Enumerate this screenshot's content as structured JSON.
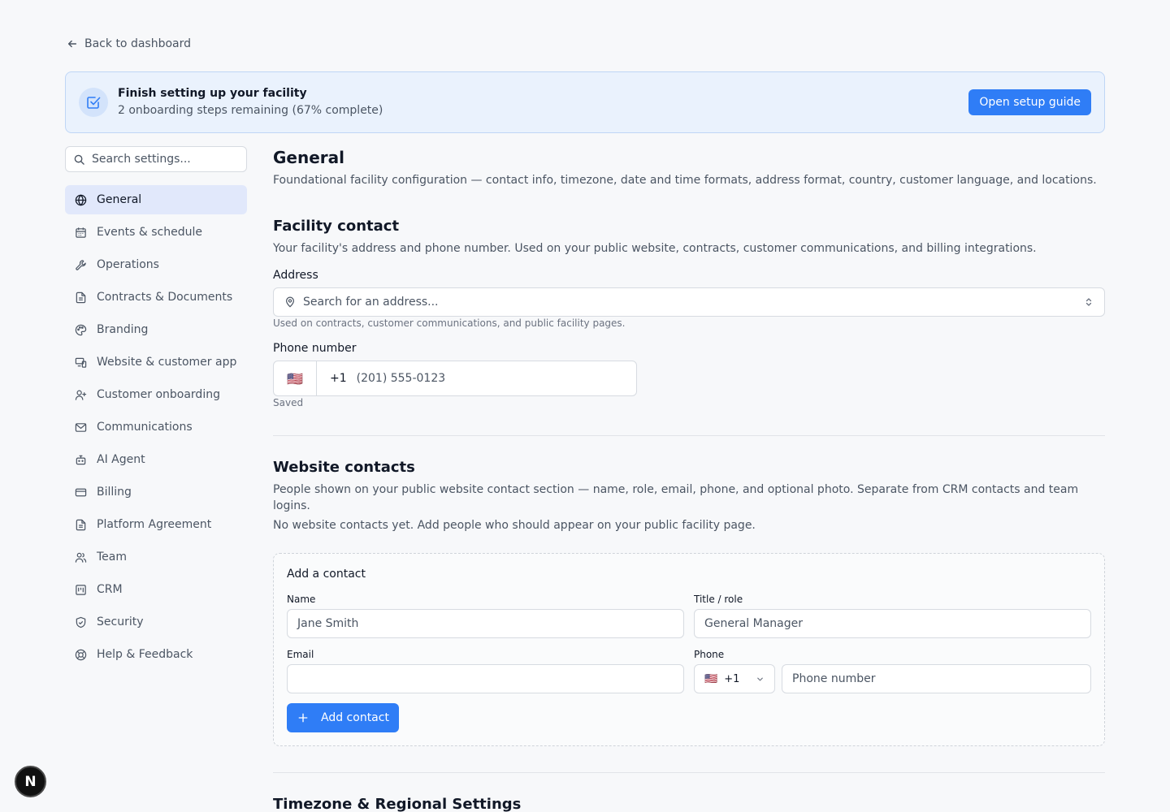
{
  "back_link": {
    "label": "Back to dashboard"
  },
  "banner": {
    "title": "Finish setting up your facility",
    "subtitle": "2 onboarding steps remaining (67% complete)",
    "button_label": "Open setup guide",
    "progress_percent": 67
  },
  "sidebar": {
    "search_placeholder": "Search settings...",
    "items": [
      {
        "label": "General",
        "icon": "globe-icon",
        "active": true
      },
      {
        "label": "Events & schedule",
        "icon": "calendar-icon"
      },
      {
        "label": "Operations",
        "icon": "wrench-icon"
      },
      {
        "label": "Contracts & Documents",
        "icon": "document-icon"
      },
      {
        "label": "Branding",
        "icon": "palette-icon"
      },
      {
        "label": "Website & customer app",
        "icon": "devices-icon"
      },
      {
        "label": "Customer onboarding",
        "icon": "user-plus-icon"
      },
      {
        "label": "Communications",
        "icon": "mail-icon"
      },
      {
        "label": "AI Agent",
        "icon": "bot-icon"
      },
      {
        "label": "Billing",
        "icon": "credit-card-icon"
      },
      {
        "label": "Platform Agreement",
        "icon": "document-icon"
      },
      {
        "label": "Team",
        "icon": "users-icon"
      },
      {
        "label": "CRM",
        "icon": "kanban-icon"
      },
      {
        "label": "Security",
        "icon": "shield-icon"
      },
      {
        "label": "Help & Feedback",
        "icon": "lifebuoy-icon"
      }
    ]
  },
  "general": {
    "title": "General",
    "description": "Foundational facility configuration — contact info, timezone, date and time formats, address format, country, customer language, and locations."
  },
  "facility_contact": {
    "title": "Facility contact",
    "description": "Your facility's address and phone number. Used on your public website, contracts, customer communications, and billing integrations.",
    "address_label": "Address",
    "address_placeholder": "Search for an address...",
    "address_hint": "Used on contracts, customer communications, and public facility pages.",
    "phone_label": "Phone number",
    "phone_flag": "🇺🇸",
    "phone_code": "+1",
    "phone_value": "(201) 555-0123",
    "phone_status": "Saved"
  },
  "website_contacts": {
    "title": "Website contacts",
    "description": "People shown on your public website contact section — name, role, email, phone, and optional photo. Separate from CRM contacts and team logins.",
    "empty_text": "No website contacts yet. Add people who should appear on your public facility page.",
    "add_form": {
      "title": "Add a contact",
      "name_label": "Name",
      "name_placeholder": "Jane Smith",
      "title_label": "Title / role",
      "title_placeholder": "General Manager",
      "email_label": "Email",
      "email_placeholder": "",
      "phone_label": "Phone",
      "phone_flag": "🇺🇸",
      "phone_code": "+1",
      "phone_placeholder": "Phone number",
      "submit_label": "Add contact"
    }
  },
  "timezone_section": {
    "title": "Timezone & Regional Settings"
  },
  "fab": {
    "label": "N"
  },
  "colors": {
    "accent": "#2f7df6",
    "banner_bg": "#eaf2fd",
    "active_nav_bg": "#e1e8fb"
  }
}
